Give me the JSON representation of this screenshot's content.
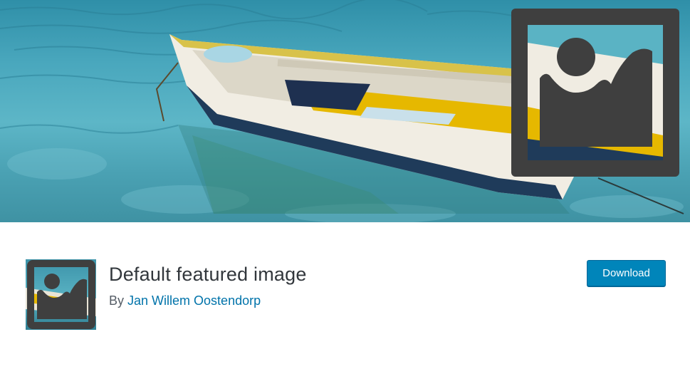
{
  "banner": {
    "image": "banner-boat-photo",
    "logo_icon": "featured-image-placeholder-icon"
  },
  "plugin": {
    "name": "Default featured image",
    "by_prefix": "By",
    "author": "Jan Willem Oostendorp",
    "icon": "featured-image-placeholder-icon"
  },
  "actions": {
    "download_label": "Download"
  },
  "colors": {
    "accent_button": "#0085ba",
    "author_link": "#0073aa",
    "title_text": "#32373c",
    "logo_gray": "#3f3f3f"
  }
}
